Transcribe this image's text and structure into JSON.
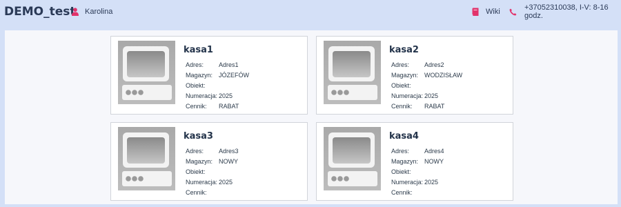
{
  "header": {
    "brand": "DEMO_test",
    "user_name": "Karolina",
    "wiki_label": "Wiki",
    "phone_text": "+37052310038, I-V: 8-16 godz.",
    "accent_color": "#e2336b"
  },
  "cards": [
    {
      "title": "kasa1",
      "fields": [
        {
          "label": "Adres:",
          "value": "Adres1"
        },
        {
          "label": "Magazyn:",
          "value": "JÓZEFÓW"
        },
        {
          "label": "Obiekt:",
          "value": ""
        },
        {
          "label": "Numeracja:",
          "value": "2025"
        },
        {
          "label": "Cennik:",
          "value": "RABAT"
        }
      ]
    },
    {
      "title": "kasa2",
      "fields": [
        {
          "label": "Adres:",
          "value": "Adres2"
        },
        {
          "label": "Magazyn:",
          "value": "WODZISŁAW"
        },
        {
          "label": "Obiekt:",
          "value": ""
        },
        {
          "label": "Numeracja:",
          "value": "2025"
        },
        {
          "label": "Cennik:",
          "value": "RABAT"
        }
      ]
    },
    {
      "title": "kasa3",
      "fields": [
        {
          "label": "Adres:",
          "value": "Adres3"
        },
        {
          "label": "Magazyn:",
          "value": "NOWY"
        },
        {
          "label": "Obiekt:",
          "value": ""
        },
        {
          "label": "Numeracja:",
          "value": "2025"
        },
        {
          "label": "Cennik:",
          "value": ""
        }
      ]
    },
    {
      "title": "kasa4",
      "fields": [
        {
          "label": "Adres:",
          "value": "Adres4"
        },
        {
          "label": "Magazyn:",
          "value": "NOWY"
        },
        {
          "label": "Obiekt:",
          "value": ""
        },
        {
          "label": "Numeracja:",
          "value": "2025"
        },
        {
          "label": "Cennik:",
          "value": ""
        }
      ]
    }
  ]
}
